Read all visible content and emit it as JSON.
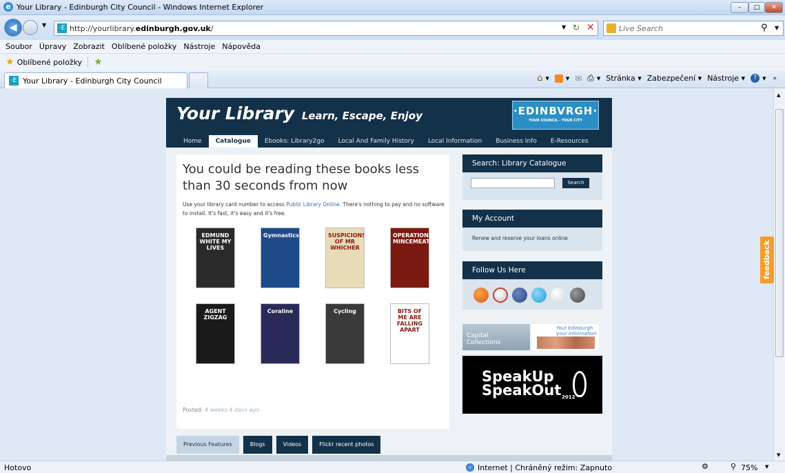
{
  "window": {
    "title": "Your Library - Edinburgh City Council - Windows Internet Explorer",
    "url_prefix": "http://yourlibrary.",
    "url_domain": "edinburgh.gov.uk",
    "url_suffix": "/",
    "search_placeholder": "Live Search"
  },
  "menu": [
    "Soubor",
    "Úpravy",
    "Zobrazit",
    "Oblíbené položky",
    "Nástroje",
    "Nápověda"
  ],
  "favorites_label": "Oblíbené položky",
  "tab_title": "Your Library - Edinburgh City Council",
  "commands": {
    "page": "Stránka",
    "security": "Zabezpečení",
    "tools": "Nástroje"
  },
  "site": {
    "title": "Your Library",
    "subtitle": "Learn, Escape, Enjoy",
    "brand": "·EDINBVRGH·",
    "brand_sub": "YOUR COUNCIL - YOUR CITY",
    "nav": [
      "Home",
      "Catalogue",
      "Ebooks: Library2go",
      "Local And Family History",
      "Local Information",
      "Business Info",
      "E-Resources"
    ],
    "active_nav": "Catalogue",
    "headline": "You could be reading these books less than 30 seconds from now",
    "intro_before": "Use your library card number to access ",
    "intro_link": "Public Library Online",
    "intro_after": ". There's nothing to pay and no software to install. It's fast, it's easy and it's free.",
    "books": [
      {
        "label": "EDMUND WHITE MY LIVES",
        "color": "#2a2a2a"
      },
      {
        "label": "Gymnastics",
        "color": "#1f4a8a"
      },
      {
        "label": "SUSPICIONS OF MR WHICHER",
        "color": "#e8dcb8"
      },
      {
        "label": "OPERATION MINCEMEAT",
        "color": "#7a1a12"
      },
      {
        "label": "AGENT ZIGZAG",
        "color": "#1a1a1a"
      },
      {
        "label": "Coraline",
        "color": "#2a2a5a"
      },
      {
        "label": "Cycling",
        "color": "#3a3a3a"
      },
      {
        "label": "BITS OF ME ARE FALLING APART",
        "color": "#ffffff"
      }
    ],
    "posted_label": "Posted:",
    "posted_time": "4 weeks 4 days ago",
    "bottom_tabs": [
      "Previous Features",
      "Blogs",
      "Videos",
      "Flickr recent photos"
    ],
    "search_widget_title": "Search: Library Catalogue",
    "search_button": "Search",
    "account_title": "My Account",
    "account_text": "Renew and reserve your loans online",
    "follow_title": "Follow Us Here",
    "social": [
      "rss-icon",
      "youtube-icon",
      "facebook-icon",
      "twitter-icon",
      "flickr-icon",
      "wordpress-icon"
    ],
    "capital_text": "Capital Collections",
    "yedin_text": "Your Edinburgh your information",
    "speak_line1": "SpeakUp",
    "speak_line2": "SpeakOut",
    "speak_year": "2012"
  },
  "feedback": "feedback",
  "status": {
    "left": "Hotovo",
    "zone": "Internet | Chráněný režim: Zapnuto",
    "zoom": "75%"
  }
}
